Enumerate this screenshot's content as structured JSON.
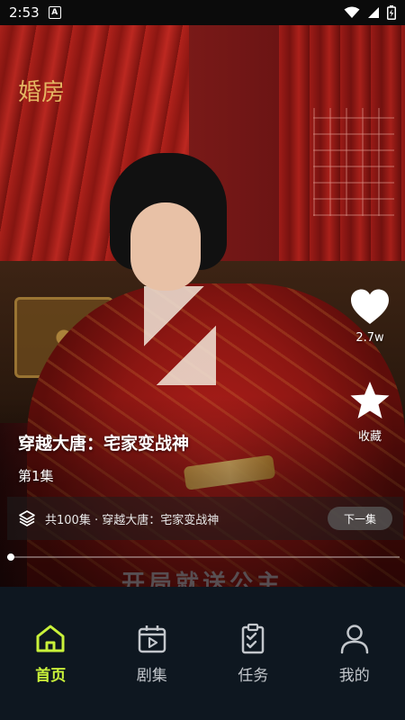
{
  "status_bar": {
    "time": "2:53",
    "notification_icon": "a-badge-icon",
    "icons": [
      "wifi-icon",
      "signal-icon",
      "battery-icon"
    ]
  },
  "player": {
    "sign_text": "婚房",
    "subtitle_text": "开局就送公主",
    "title": "穿越大唐：宅家变战神",
    "episode": "第1集",
    "progress": 0.01
  },
  "actions": {
    "like_icon": "heart-icon",
    "like_count": "2.7w",
    "favorite_icon": "star-icon",
    "favorite_label": "收藏"
  },
  "series": {
    "icon": "layers-icon",
    "text": "共100集 · 穿越大唐：宅家变战神",
    "next_label": "下一集"
  },
  "tab_bar": {
    "active_color": "#c9f23a",
    "items": [
      {
        "label": "首页",
        "icon": "home-icon",
        "active": true
      },
      {
        "label": "剧集",
        "icon": "play-calendar-icon",
        "active": false
      },
      {
        "label": "任务",
        "icon": "task-checklist-icon",
        "active": false
      },
      {
        "label": "我的",
        "icon": "user-icon",
        "active": false
      }
    ]
  }
}
